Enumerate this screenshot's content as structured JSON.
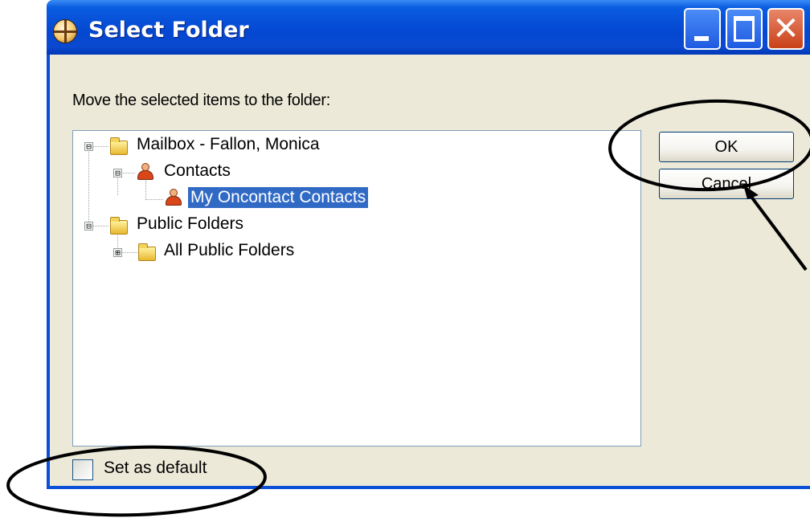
{
  "window": {
    "title": "Select Folder",
    "title_icon": "app-globe-icon",
    "controls": {
      "minimize": "minimize-icon",
      "maximize": "maximize-icon",
      "close": "✕"
    },
    "titlebar_color": "#0a4fd6",
    "client_color": "#ece9d8"
  },
  "dialog": {
    "prompt": "Move the selected items to the folder:",
    "tree": [
      {
        "label": "Mailbox - Fallon, Monica",
        "icon": "folder-icon",
        "expander": "⊟",
        "expanded": true,
        "selected": false
      },
      {
        "label": "Contacts",
        "icon": "contacts-icon",
        "expander": "⊟",
        "expanded": true,
        "selected": false
      },
      {
        "label": "My Oncontact Contacts",
        "icon": "contacts-icon",
        "selected": true
      },
      {
        "label": "Public Folders",
        "icon": "folder-icon",
        "expander": "⊟",
        "expanded": true,
        "selected": false
      },
      {
        "label": "All Public Folders",
        "icon": "folder-icon",
        "expander": "⊞",
        "expanded": false,
        "selected": false
      }
    ],
    "buttons": {
      "ok": "OK",
      "cancel": "Cancel"
    },
    "checkbox": {
      "label": "Set as default",
      "checked": false
    },
    "selection_color": "#316ac5"
  },
  "annotations": {
    "color": "#000000",
    "marks": [
      "ellipse around OK button",
      "ellipse around Set as default checkbox",
      "arrow pointing to Cancel button"
    ]
  }
}
